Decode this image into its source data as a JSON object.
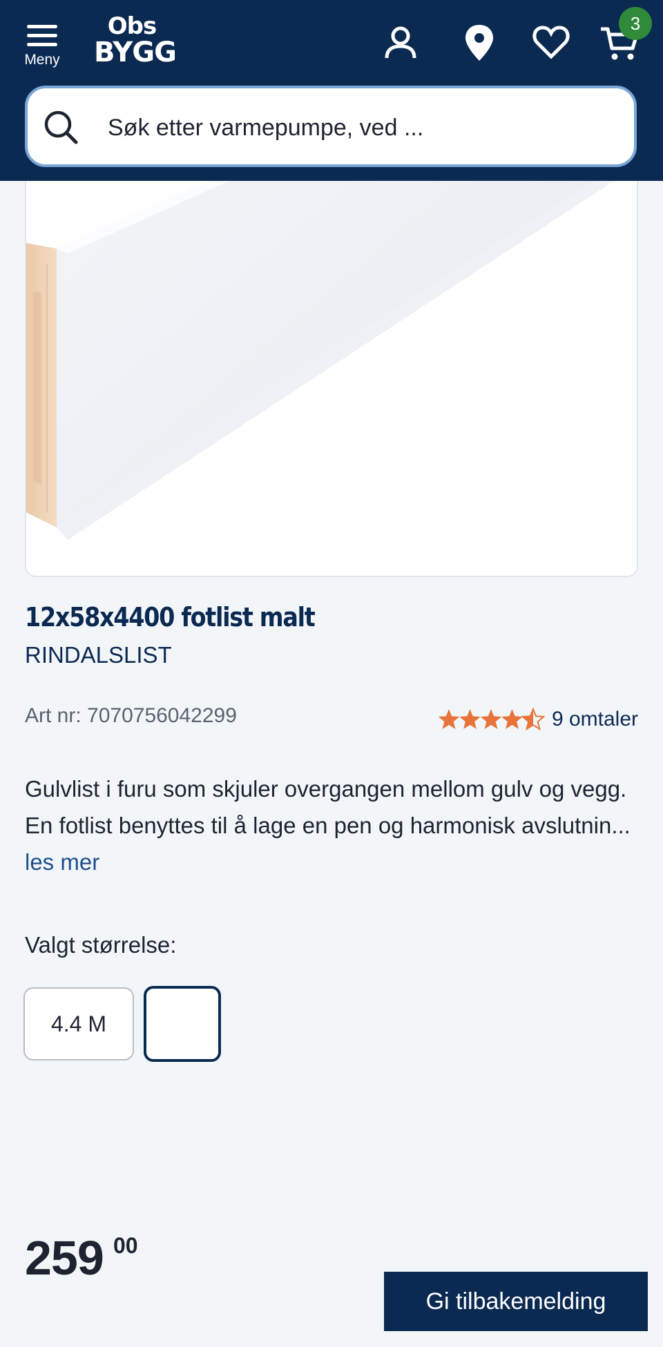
{
  "header": {
    "menu_label": "Meny",
    "logo_line1": "Obs",
    "logo_line2": "BYGG",
    "cart_count": "3",
    "icons": [
      "menu-icon",
      "user-icon",
      "location-pin-icon",
      "heart-icon",
      "cart-icon"
    ]
  },
  "search": {
    "placeholder": "Søk etter varmepumpe, ved ..."
  },
  "product": {
    "title": "12x58x4400 fotlist malt",
    "brand": "RINDALSLIST",
    "art_nr": "Art nr: 7070756042299",
    "rating": 4.5,
    "rating_max": 5,
    "reviews": "9 omtaler",
    "description": "Gulvlist i furu som skjuler overgangen mellom gulv og vegg. En fotlist benyttes til å lage en pen og harmonisk avslutnin...",
    "read_more": "les mer",
    "size_label": "Valgt størrelse:",
    "size_option": "4.4 M",
    "price_main": "259",
    "price_decimals": "00"
  },
  "feedback_button": "Gi tilbakemelding",
  "colors": {
    "header": "#0b2a52",
    "star": "#e8743b",
    "badge": "#2f8a3a",
    "search_border": "#7aa7d8"
  }
}
